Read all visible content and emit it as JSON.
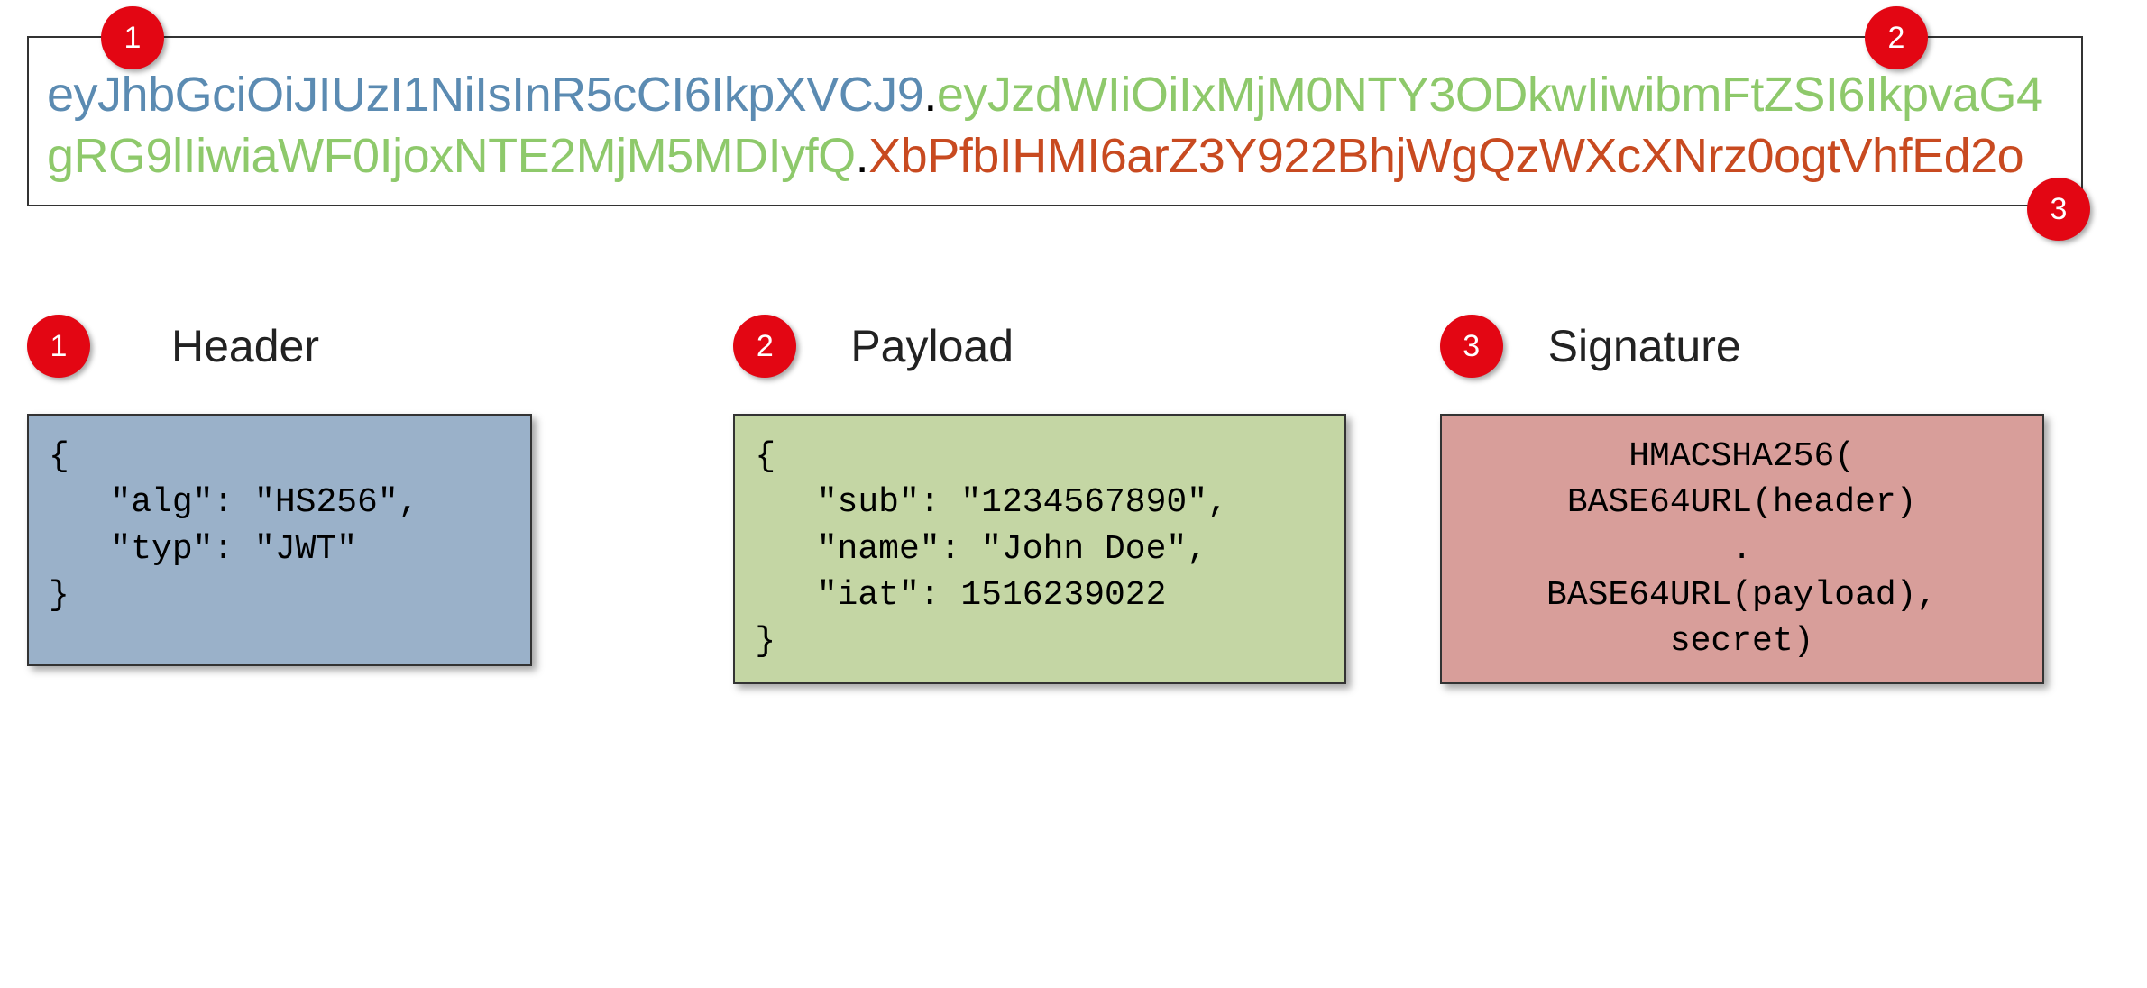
{
  "jwt": {
    "header_b64": "eyJhbGciOiJIUzI1NiIsInR5cCI6IkpXVCJ9",
    "payload_b64": "eyJzdWIiOiIxMjM0NTY3ODkwIiwibmFtZSI6IkpvaG4gRG9lIiwiaWF0IjoxNTE2MjM5MDIyfQ",
    "signature_b64": "XbPfbIHMI6arZ3Y922BhjWgQzWXcXNrz0ogtVhfEd2o",
    "dot": "."
  },
  "badges": {
    "header_top": "1",
    "payload_top": "2",
    "signature_top": "3",
    "header_section": "1",
    "payload_section": "2",
    "signature_section": "3"
  },
  "sections": {
    "header": {
      "title": "Header",
      "code": "{\n   \"alg\": \"HS256\",\n   \"typ\": \"JWT\"\n}"
    },
    "payload": {
      "title": "Payload",
      "code": "{\n   \"sub\": \"1234567890\",\n   \"name\": \"John Doe\",\n   \"iat\": 1516239022\n}"
    },
    "signature": {
      "title": "Signature",
      "code": "HMACSHA256(\nBASE64URL(header)\n.\nBASE64URL(payload),\nsecret)"
    }
  }
}
